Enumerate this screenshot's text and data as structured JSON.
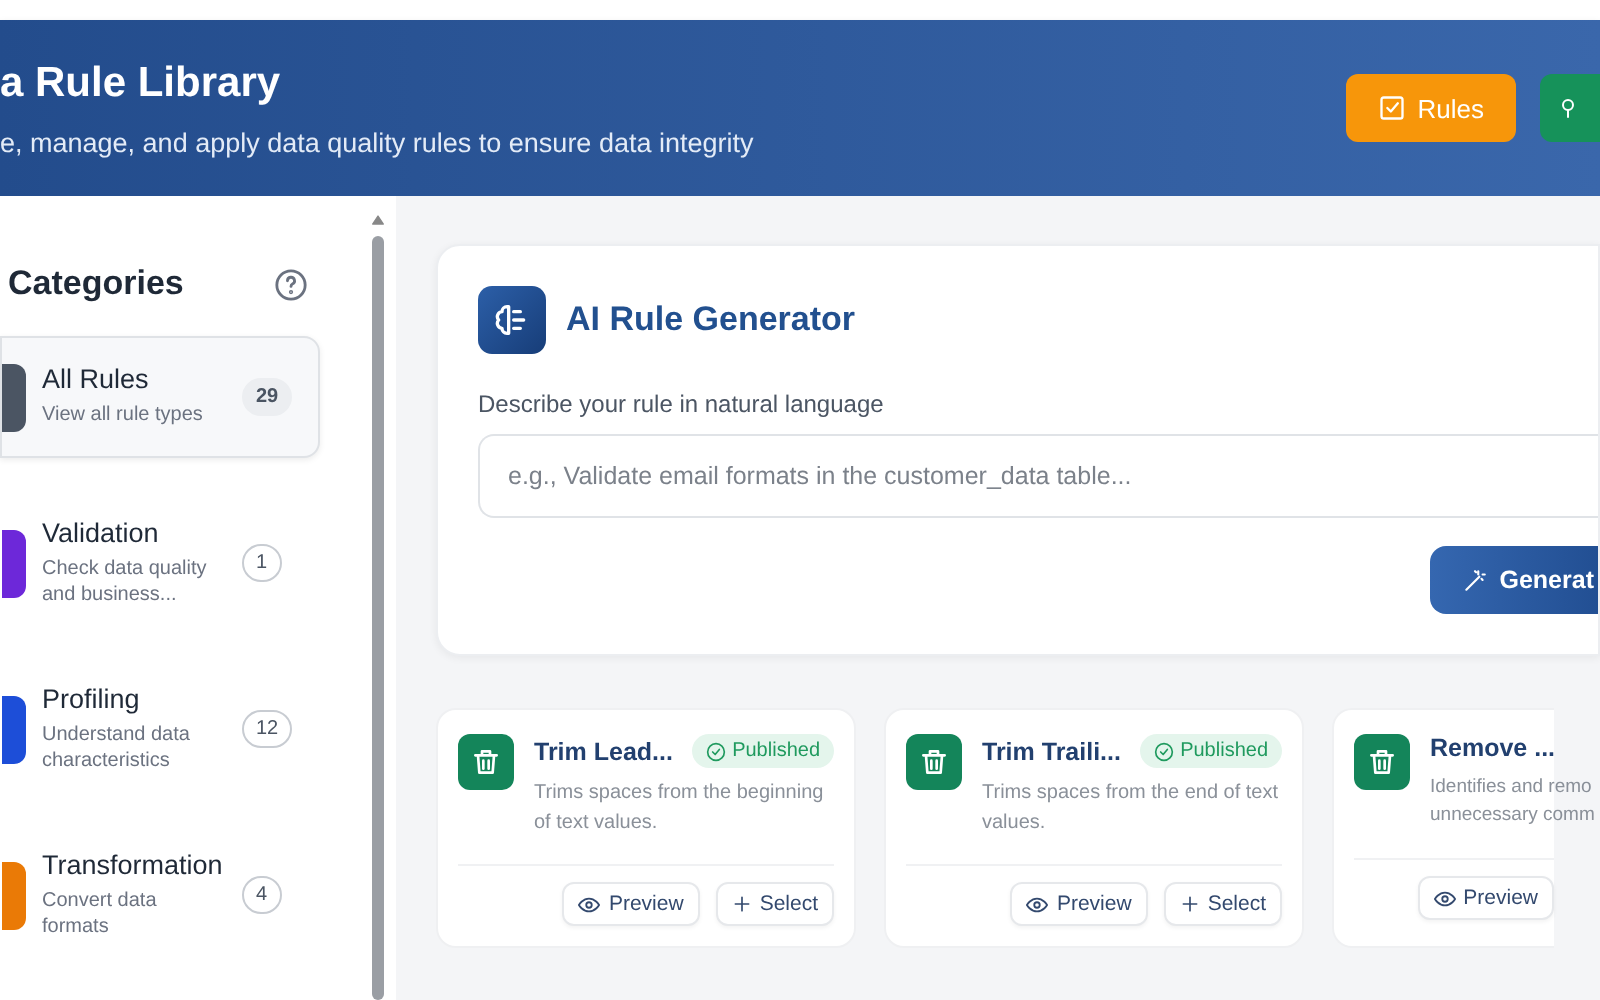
{
  "header": {
    "title": "a Rule Library",
    "subtitle": "e, manage, and apply data quality rules to ensure data integrity",
    "buttons": [
      {
        "label": "Rules",
        "kind": "rules"
      },
      {
        "kind": "other"
      }
    ]
  },
  "sidebar": {
    "title": "Categories",
    "items": [
      {
        "name": "All Rules",
        "description": "View all rule types",
        "count": "29",
        "color": "#4b5563",
        "selected": true
      },
      {
        "name": "Validation",
        "description": "Check data quality and business...",
        "count": "1",
        "color": "#6d28d9",
        "selected": false
      },
      {
        "name": "Profiling",
        "description": "Understand data characteristics",
        "count": "12",
        "color": "#1d4ed8",
        "selected": false
      },
      {
        "name": "Transformation",
        "description": "Convert data formats",
        "count": "4",
        "color": "#ea7a06",
        "selected": false
      }
    ]
  },
  "generator": {
    "title": "AI Rule Generator",
    "label": "Describe your rule in natural language",
    "placeholder": "e.g., Validate email formats in the customer_data table...",
    "button": "Generat"
  },
  "rules": [
    {
      "name": "Trim Lead...",
      "status": "Published",
      "description": "Trims spaces from the beginning of text values.",
      "actions": [
        "Preview",
        "Select"
      ]
    },
    {
      "name": "Trim Traili...",
      "status": "Published",
      "description": "Trims spaces from the end of text values.",
      "actions": [
        "Preview",
        "Select"
      ]
    },
    {
      "name": "Remove ...",
      "description": "Identifies and remo\nunnecessary comm",
      "actions": [
        "Preview"
      ]
    }
  ]
}
